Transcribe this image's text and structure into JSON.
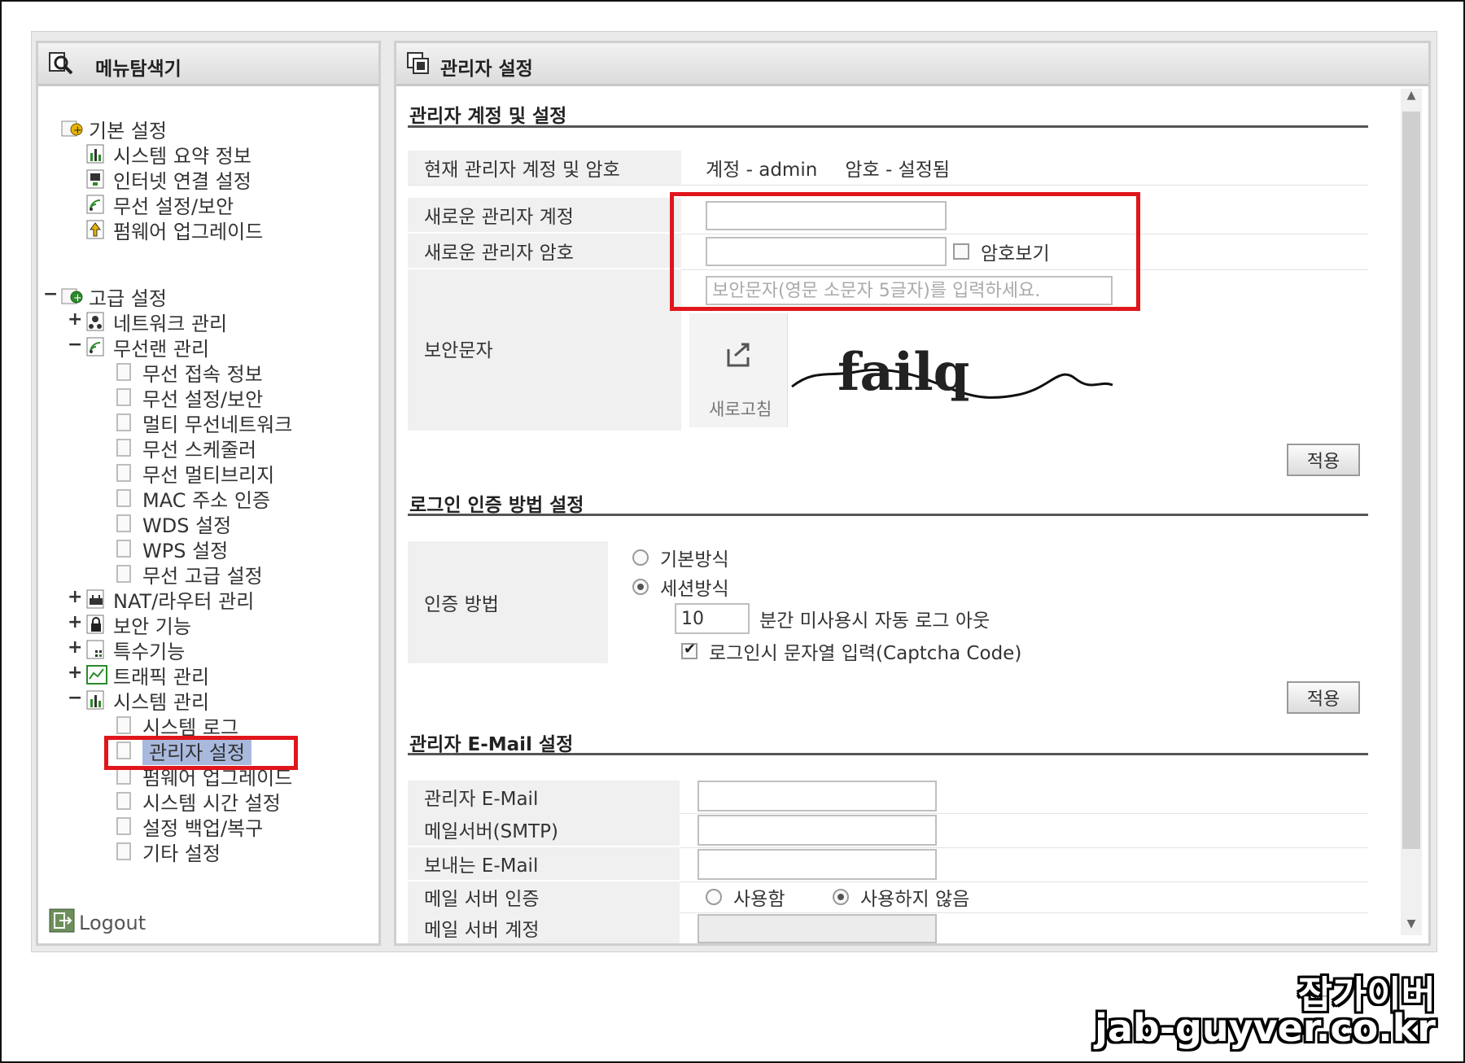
{
  "left_panel": {
    "title": "메뉴탐색기",
    "basic_group": {
      "label": "기본 설정",
      "items": [
        "시스템 요약 정보",
        "인터넷 연결 설정",
        "무선 설정/보안",
        "펌웨어 업그레이드"
      ]
    },
    "advanced_group": {
      "label": "고급 설정",
      "expander": "−",
      "network": {
        "label": "네트워크 관리",
        "expander": "+"
      },
      "wireless": {
        "label": "무선랜 관리",
        "expander": "−",
        "items": [
          "무선 접속 정보",
          "무선 설정/보안",
          "멀티 무선네트워크",
          "무선 스케줄러",
          "무선 멀티브리지",
          "MAC 주소 인증",
          "WDS 설정",
          "WPS 설정",
          "무선 고급 설정"
        ]
      },
      "nat": {
        "label": "NAT/라우터 관리",
        "expander": "+"
      },
      "security": {
        "label": "보안 기능",
        "expander": "+"
      },
      "special": {
        "label": "특수기능",
        "expander": "+"
      },
      "traffic": {
        "label": "트래픽 관리",
        "expander": "+"
      },
      "system": {
        "label": "시스템 관리",
        "expander": "−",
        "items": [
          "시스템 로그",
          "관리자 설정",
          "펌웨어 업그레이드",
          "시스템 시간 설정",
          "설정 백업/복구",
          "기타 설정"
        ],
        "selected": "관리자 설정"
      }
    },
    "logout_label": "Logout"
  },
  "right_panel": {
    "title": "관리자 설정",
    "account_section": {
      "title": "관리자 계정 및 설정",
      "current_label": "현재 관리자 계정 및 암호",
      "current_account": "계정 - admin",
      "current_password": "암호 - 설정됨",
      "new_account_label": "새로운 관리자 계정",
      "new_account_value": "",
      "new_password_label": "새로운 관리자 암호",
      "new_password_value": "",
      "show_password_label": "암호보기",
      "show_password_checked": false,
      "captcha_label": "보안문자",
      "captcha_placeholder": "보안문자(영문 소문자 5글자)를 입력하세요.",
      "captcha_text": "failq",
      "refresh_label": "새로고침",
      "apply_label": "적용"
    },
    "login_section": {
      "title": "로그인 인증 방법 설정",
      "auth_label": "인증 방법",
      "option_basic": "기본방식",
      "option_session": "세션방식",
      "selected": "세션방식",
      "timeout_value": "10",
      "timeout_suffix": "분간 미사용시 자동 로그 아웃",
      "captcha_checkbox_label": "로그인시 문자열 입력(Captcha Code)",
      "captcha_checked": true,
      "apply_label": "적용"
    },
    "email_section": {
      "title": "관리자 E-Mail 설정",
      "email_label": "관리자 E-Mail",
      "email_value": "",
      "smtp_label": "메일서버(SMTP)",
      "smtp_value": "",
      "sender_label": "보내는 E-Mail",
      "sender_value": "",
      "auth_label": "메일 서버 인증",
      "auth_use": "사용함",
      "auth_no_use": "사용하지 않음",
      "auth_selected": "사용하지 않음",
      "account_label": "메일 서버 계정"
    }
  },
  "watermark": {
    "line1": "잡가이버",
    "line2": "jab-guyver.co.kr"
  },
  "colors": {
    "highlight_red": "#e0161c",
    "selected_bg": "#a9b9de",
    "label_bg": "#f0f0f0"
  }
}
